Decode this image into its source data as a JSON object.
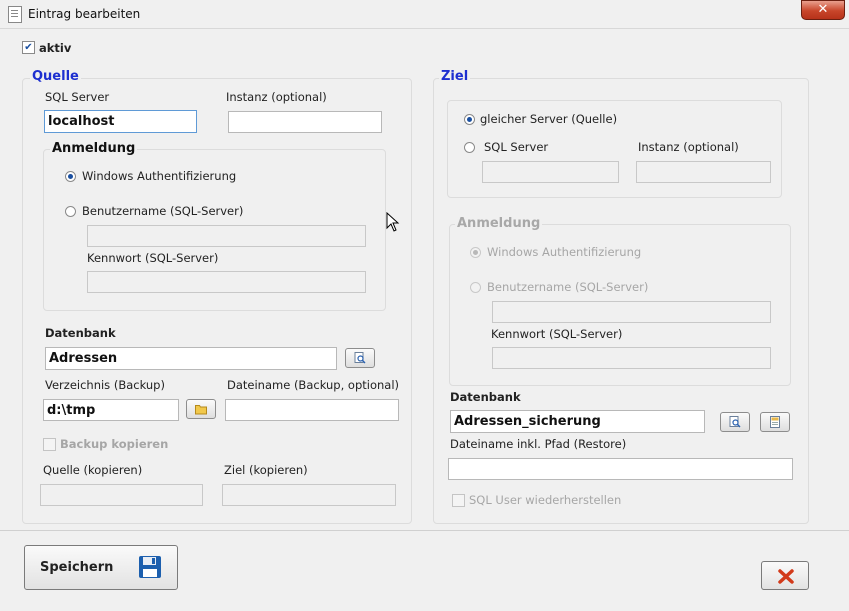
{
  "window": {
    "title": "Eintrag bearbeiten",
    "close_label": "✕"
  },
  "aktiv": {
    "label": "aktiv",
    "checked": true
  },
  "quelle": {
    "legend": "Quelle",
    "sql_server_label": "SQL Server",
    "sql_server_value": "localhost",
    "instanz_label": "Instanz (optional)",
    "instanz_value": "",
    "anmeldung": {
      "legend": "Anmeldung",
      "windows_label": "Windows Authentifizierung",
      "benutzer_label": "Benutzername (SQL-Server)",
      "benutzer_value": "",
      "kennwort_label": "Kennwort (SQL-Server)",
      "kennwort_value": ""
    },
    "datenbank_label": "Datenbank",
    "datenbank_value": "Adressen",
    "verzeichnis_label": "Verzeichnis (Backup)",
    "verzeichnis_value": "d:\\tmp",
    "dateiname_label": "Dateiname (Backup, optional)",
    "dateiname_value": "",
    "backup_kopieren_label": "Backup kopieren",
    "quelle_kopieren_label": "Quelle (kopieren)",
    "ziel_kopieren_label": "Ziel (kopieren)"
  },
  "ziel": {
    "legend": "Ziel",
    "gleicher_server_label": "gleicher Server (Quelle)",
    "sql_server_label": "SQL Server",
    "instanz_label": "Instanz (optional)",
    "anmeldung": {
      "legend": "Anmeldung",
      "windows_label": "Windows Authentifizierung",
      "benutzer_label": "Benutzername (SQL-Server)",
      "kennwort_label": "Kennwort (SQL-Server)"
    },
    "datenbank_label": "Datenbank",
    "datenbank_value": "Adressen_sicherung",
    "dateiname_restore_label": "Dateiname inkl. Pfad (Restore)",
    "dateiname_restore_value": "",
    "sql_user_label": "SQL User wiederherstellen"
  },
  "footer": {
    "save_label": "Speichern"
  },
  "colors": {
    "legend_blue": "#1d2fd0",
    "cancel_red": "#d23a1a",
    "save_icon_blue": "#1c5fae"
  }
}
